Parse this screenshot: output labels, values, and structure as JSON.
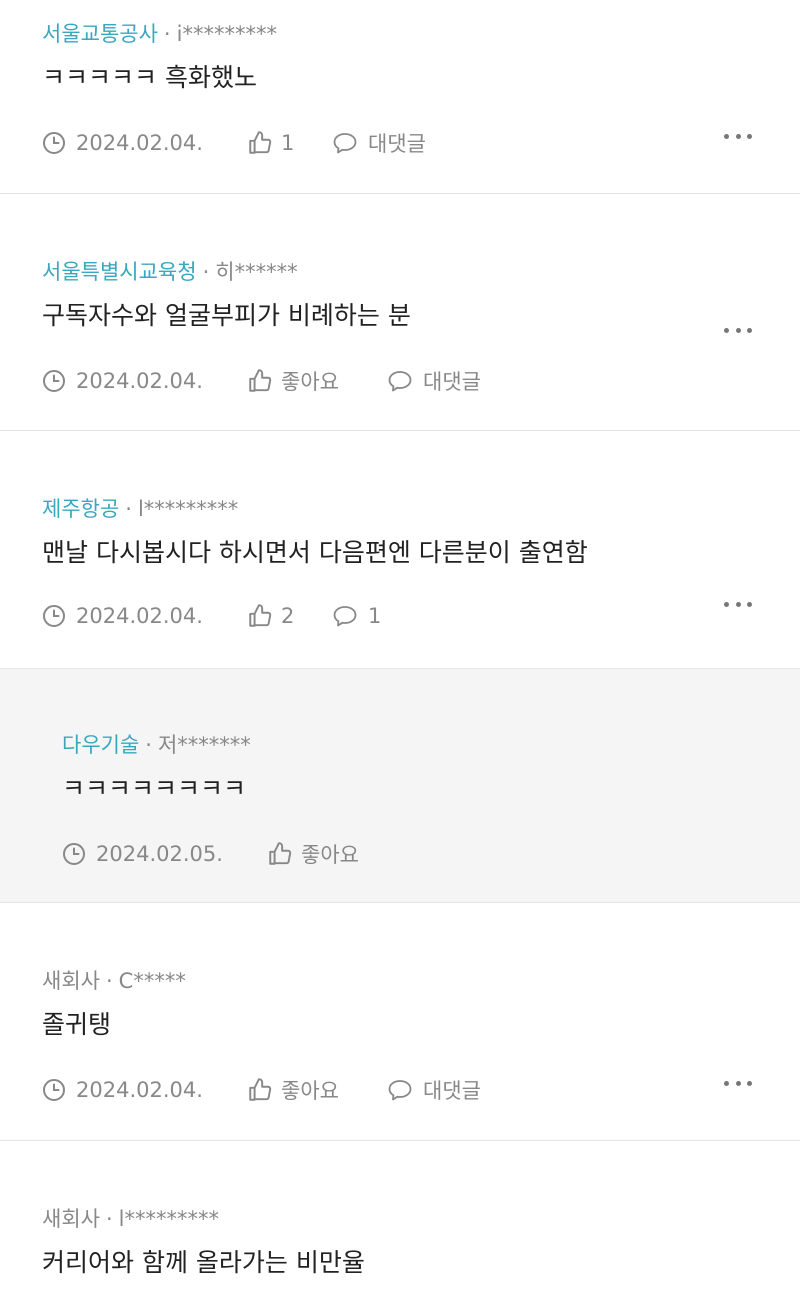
{
  "comments": [
    {
      "author": "서울교통공사",
      "user": "i*********",
      "text": "ㅋㅋㅋㅋㅋ 흑화했노",
      "date": "2024.02.04.",
      "likes": "1",
      "reply": "대댓글"
    },
    {
      "author": "서울특별시교육청",
      "user": "히******",
      "text": "구독자수와 얼굴부피가 비례하는 분",
      "date": "2024.02.04.",
      "likes": "좋아요",
      "reply": "대댓글"
    },
    {
      "author": "제주항공",
      "user": "l*********",
      "text": "맨날 다시봅시다 하시면서 다음편엔 다른분이 출연함",
      "date": "2024.02.04.",
      "likes": "2",
      "reply": "1"
    },
    {
      "author": "다우기술",
      "user": "저*******",
      "text": "ㅋㅋㅋㅋㅋㅋㅋㅋ",
      "date": "2024.02.05.",
      "likes": "좋아요"
    },
    {
      "author": "새회사",
      "user": "C*****",
      "text": "졸귀탱",
      "date": "2024.02.04.",
      "likes": "좋아요",
      "reply": "대댓글"
    },
    {
      "author": "새회사",
      "user": "l*********",
      "text": "커리어와 함께 올라가는 비만율"
    }
  ],
  "separator": "·",
  "icons": {
    "date": "clock-icon",
    "like": "thumbs-up-icon",
    "reply": "speech-bubble-icon",
    "more": "more-options-icon"
  },
  "colors": {
    "company_link": "#3aa7c0",
    "meta": "#888888",
    "reply_bg": "#f5f5f5"
  }
}
